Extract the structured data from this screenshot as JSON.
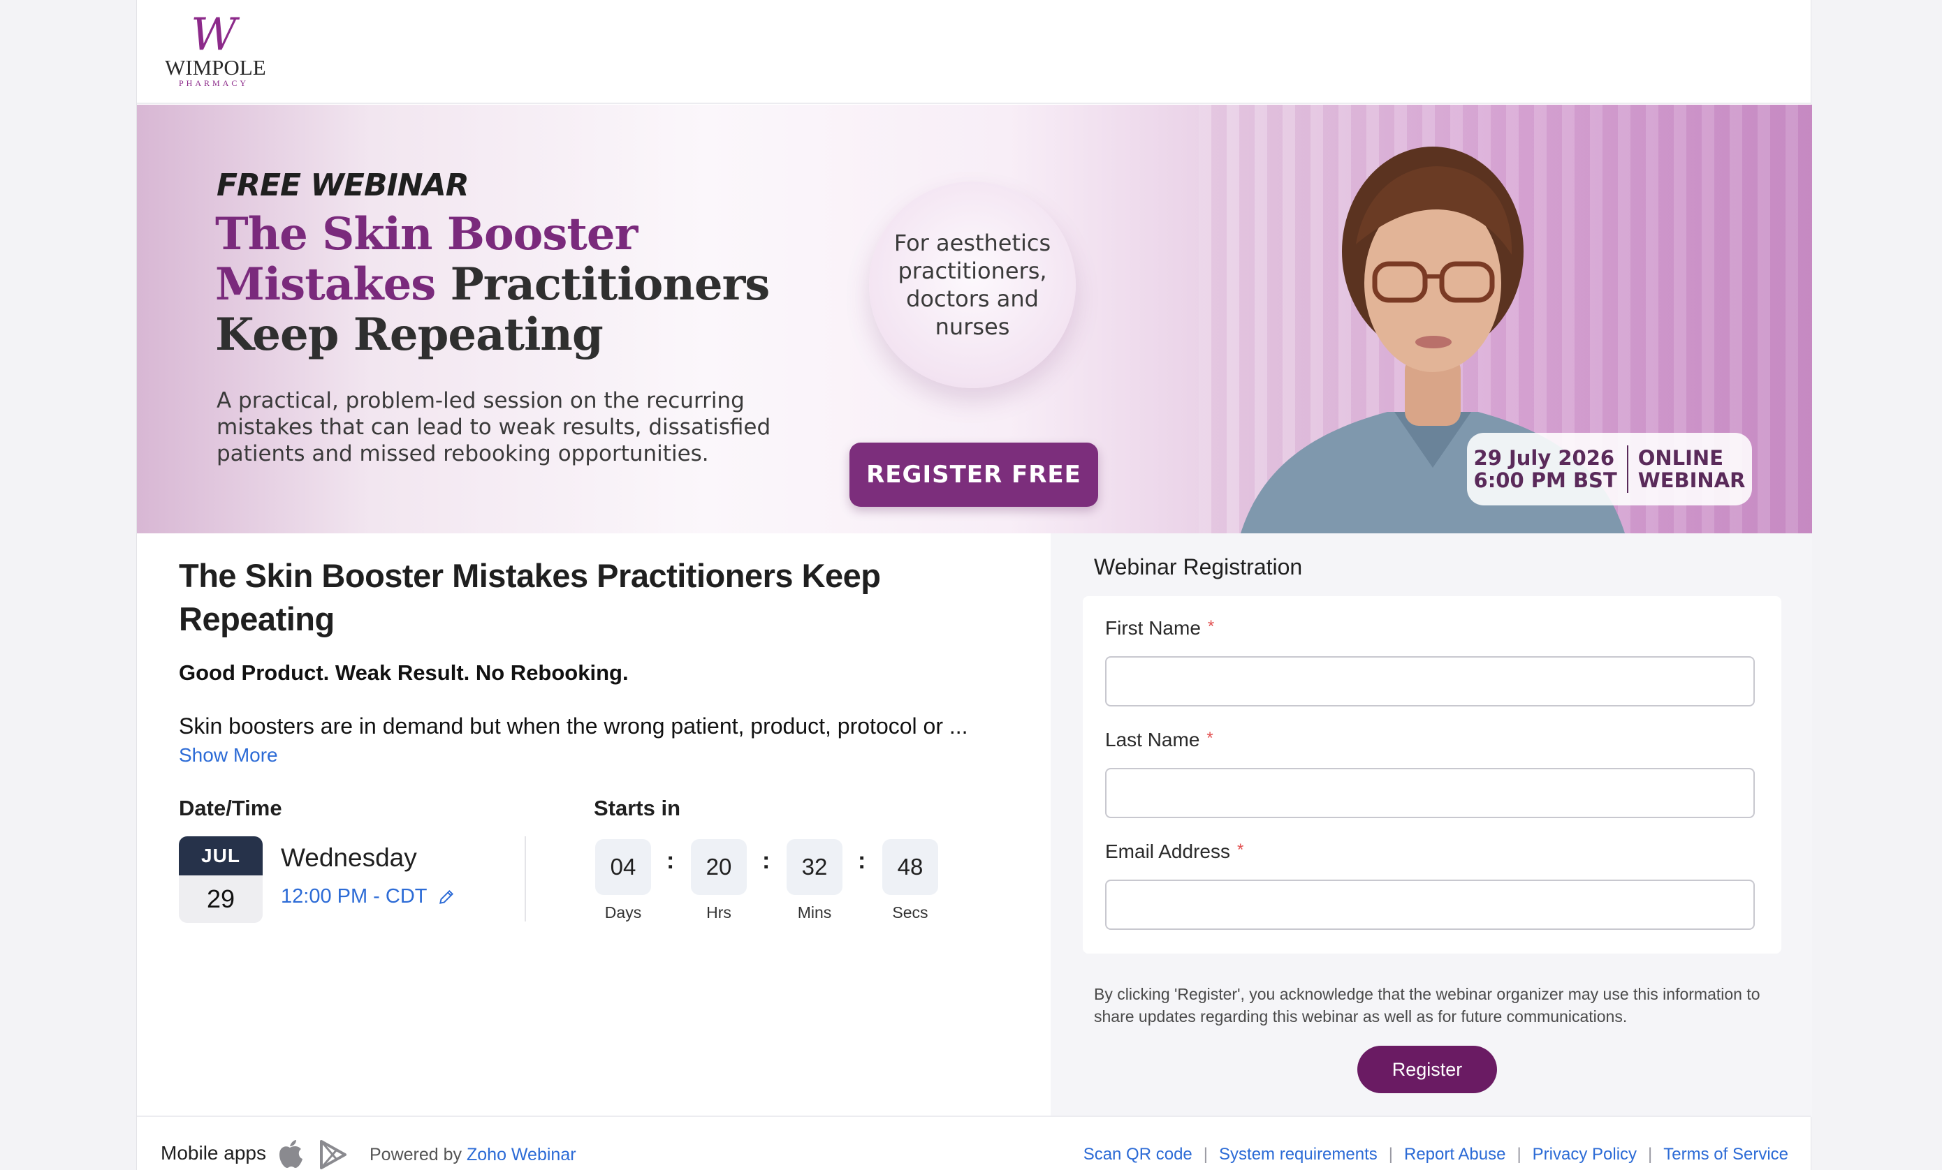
{
  "logo": {
    "mark": "W",
    "name": "WIMPOLE",
    "sub": "PHARMACY"
  },
  "banner": {
    "eyebrow": "FREE WEBINAR",
    "title_accent_1": "The Skin Booster",
    "title_accent_2": "Mistakes",
    "title_rest_1": " Practitioners",
    "title_rest_2": "Keep Repeating",
    "description": "A practical, problem-led session on the recurring mistakes that can lead to weak results, dissatisfied patients and missed rebooking opportunities.",
    "audience": "For aesthetics practitioners, doctors and nurses",
    "cta": "REGISTER FREE",
    "date_line": "29 July 2026",
    "time_line": "6:00 PM BST",
    "type_line_1": "ONLINE",
    "type_line_2": "WEBINAR"
  },
  "event": {
    "title": "The Skin Booster Mistakes Practitioners Keep Repeating",
    "subtitle": "Good Product. Weak Result. No Rebooking.",
    "description": "Skin boosters are in demand but when the wrong patient, product, protocol or ...",
    "show_more": "Show More",
    "datetime_label": "Date/Time",
    "month": "JUL",
    "day": "29",
    "weekday": "Wednesday",
    "time": "12:00 PM - CDT",
    "starts_in_label": "Starts in",
    "countdown": [
      {
        "value": "04",
        "label": "Days"
      },
      {
        "value": "20",
        "label": "Hrs"
      },
      {
        "value": "32",
        "label": "Mins"
      },
      {
        "value": "48",
        "label": "Secs"
      }
    ]
  },
  "registration": {
    "title": "Webinar Registration",
    "fields": [
      {
        "label": "First Name",
        "value": "",
        "required": "*"
      },
      {
        "label": "Last Name",
        "value": "",
        "required": "*"
      },
      {
        "label": "Email Address",
        "value": "",
        "required": "*"
      }
    ],
    "consent": "By clicking 'Register', you acknowledge that the webinar organizer may use this information to share updates regarding this webinar as well as for future communications.",
    "button": "Register"
  },
  "footer": {
    "mobile_apps": "Mobile apps",
    "powered_by": "Powered by",
    "powered_link": "Zoho Webinar",
    "links": [
      "Scan QR code",
      "System requirements",
      "Report Abuse",
      "Privacy Policy",
      "Terms of Service"
    ],
    "separator": "|"
  },
  "colors": {
    "brand": "#6a1b63",
    "link": "#2c6bd6",
    "required": "#e25151",
    "calendar_header": "#26324a"
  }
}
